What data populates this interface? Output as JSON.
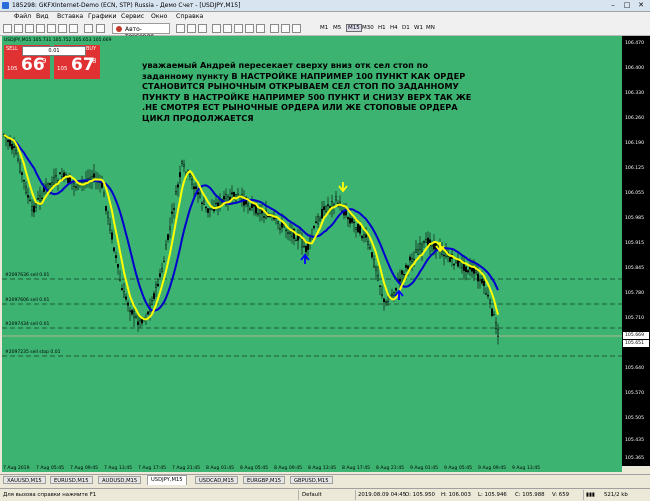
{
  "window": {
    "title": "185298: GKFXInternet-Demo (ECN, STP) Russia - Демо Счет - [USDJPY,M15]"
  },
  "menu": [
    "Файл",
    "Вид",
    "Вставка",
    "Графики",
    "Сервис",
    "Окно",
    "Справка"
  ],
  "toolbar": {
    "autotrade_label": "Авто-торговля",
    "timeframes": [
      "M1",
      "M5",
      "M15",
      "M30",
      "H1",
      "H4",
      "D1",
      "W1",
      "MN"
    ],
    "active_timeframe": "M15"
  },
  "chart": {
    "symbol_header": "USDJPY,M15 105.731 105.752 105.653 105.669",
    "indicator_label": "105.971/105.794",
    "background_color": "#3cb371",
    "fast_ma_color": "#ffff00",
    "slow_ma_color": "#0000cc",
    "annotation": "уважаемый Андрей пересекает сверху вниз отк сел стоп по заданному пункту В НАСТРОЙКЕ НАПРИМЕР 100 ПУНКТ КАК ОРДЕР СТАНОВИТСЯ РЫНОЧНЫМ ОТКРЫВАЕМ СЕЛ СТОП ПО ЗАДАННОМУ ПУНКТУ В НАСТРОЙКЕ НАПРИМЕР 500 ПУНКТ  И СНИЗУ ВЕРХ ТАК ЖЕ .НЕ СМОТРЯ ЕСТ РЫНОЧНЫЕ   ОРДЕРА ИЛИ ЖЕ СТОПОВЫЕ ОРДЕРА ЦИКЛ ПРОДОЛЖАЕТСЯ",
    "orders": [
      {
        "label": "#2097636 sell 0.01"
      },
      {
        "label": "#2097606 sell 0.01"
      },
      {
        "label": "#2097434 sell 0.01"
      },
      {
        "label": "#2097235 sell stop 0.01"
      }
    ]
  },
  "trade_panel": {
    "sell_label": "SELL",
    "buy_label": "BUY",
    "lot": "0.01",
    "sell_price_small": "105",
    "sell_price_big": "66",
    "sell_price_sup": "9",
    "buy_price_small": "105",
    "buy_price_big": "67",
    "buy_price_sup": "8"
  },
  "price_axis": {
    "ticks": [
      "106.470",
      "106.400",
      "106.330",
      "106.260",
      "106.190",
      "106.125",
      "106.055",
      "105.985",
      "105.915",
      "105.845",
      "105.780",
      "105.710",
      "105.640",
      "105.570",
      "105.505",
      "105.435",
      "105.365"
    ],
    "current_price": "105.669",
    "current_price_2": "105.651"
  },
  "time_axis": {
    "ticks": [
      "7 Aug 2019",
      "7 Aug 05:45",
      "7 Aug 09:45",
      "7 Aug 13:45",
      "7 Aug 17:45",
      "7 Aug 21:45",
      "8 Aug 01:45",
      "8 Aug 05:45",
      "8 Aug 09:45",
      "8 Aug 13:45",
      "8 Aug 17:45",
      "8 Aug 21:45",
      "9 Aug 01:45",
      "9 Aug 05:45",
      "9 Aug 09:45",
      "9 Aug 13:45"
    ]
  },
  "tabs": [
    "XAUUSD,M15",
    "EURUSD,M15",
    "AUDUSD,M15",
    "USDJPY,M15",
    "USDCAD,M15",
    "EURGBP,M15",
    "GBPUSD,M15"
  ],
  "active_tab": "USDJPY,M15",
  "status": {
    "help": "Для вызова справки нажмите F1",
    "profile": "Default",
    "datetime": "2019.08.09 04:45",
    "open": "O: 105.950",
    "high": "H: 106.003",
    "low": "L: 105.946",
    "close": "C: 105.988",
    "volume": "V: 659",
    "traffic": "521/2 kb"
  }
}
